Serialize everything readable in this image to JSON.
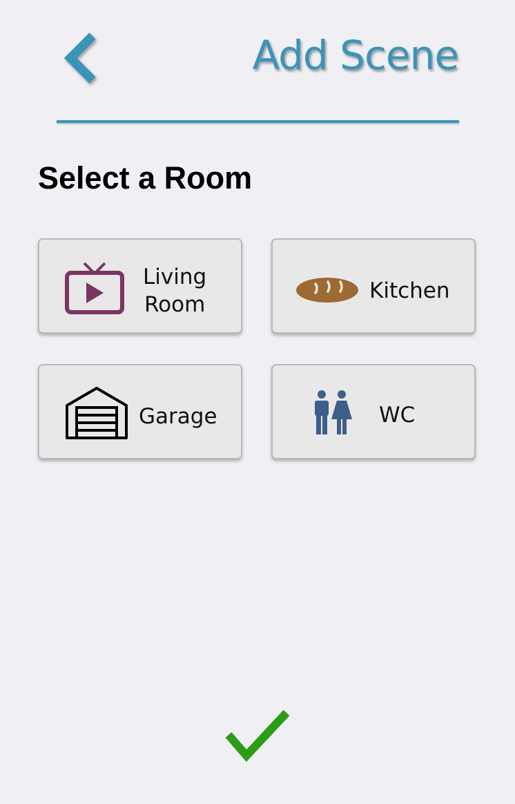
{
  "header": {
    "title": "Add Scene",
    "back_icon": "chevron-left-icon",
    "accent_color": "#3b94b8"
  },
  "section": {
    "heading": "Select a Room"
  },
  "rooms": [
    {
      "label_line1": "Living",
      "label_line2": "Room",
      "icon": "tv-icon",
      "icon_color": "#7a3563"
    },
    {
      "label": "Kitchen",
      "icon": "bread-icon",
      "icon_color": "#9c6a35"
    },
    {
      "label": "Garage",
      "icon": "garage-door-icon",
      "icon_color": "#000000"
    },
    {
      "label": "WC",
      "icon": "restroom-icon",
      "icon_color": "#3d5f89"
    }
  ],
  "footer": {
    "confirm_icon": "checkmark-icon",
    "confirm_color": "#2a9d14"
  }
}
